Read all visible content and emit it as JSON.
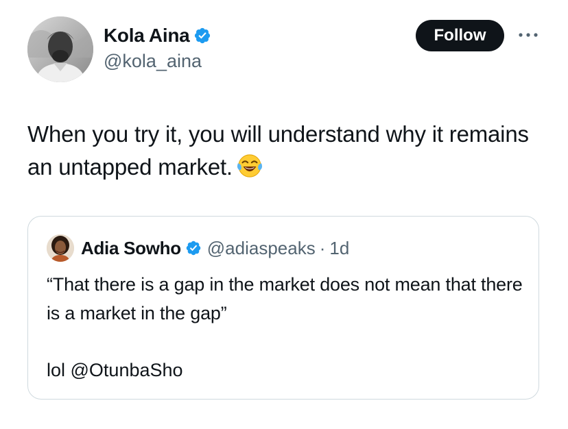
{
  "author": {
    "display_name": "Kola Aina",
    "handle": "@kola_aina",
    "verified_icon": "verified-badge-icon",
    "verified_color": "#1d9bf0"
  },
  "actions": {
    "follow_label": "Follow",
    "more_icon": "more-horizontal-icon"
  },
  "tweet": {
    "text": "When you try it, you will understand why it remains an untapped market.",
    "emoji_icon": "face-with-tears-of-joy-emoji"
  },
  "quote": {
    "display_name": "Adia Sowho",
    "handle": "@adiaspeaks",
    "separator": "·",
    "time": "1d",
    "body": "“That there is a gap in the market does not mean that there is a market in the gap”",
    "footer": "lol @OtunbaSho"
  },
  "colors": {
    "text_primary": "#0f1419",
    "text_secondary": "#536471",
    "border": "#cfd9de",
    "follow_bg": "#0f1419"
  }
}
